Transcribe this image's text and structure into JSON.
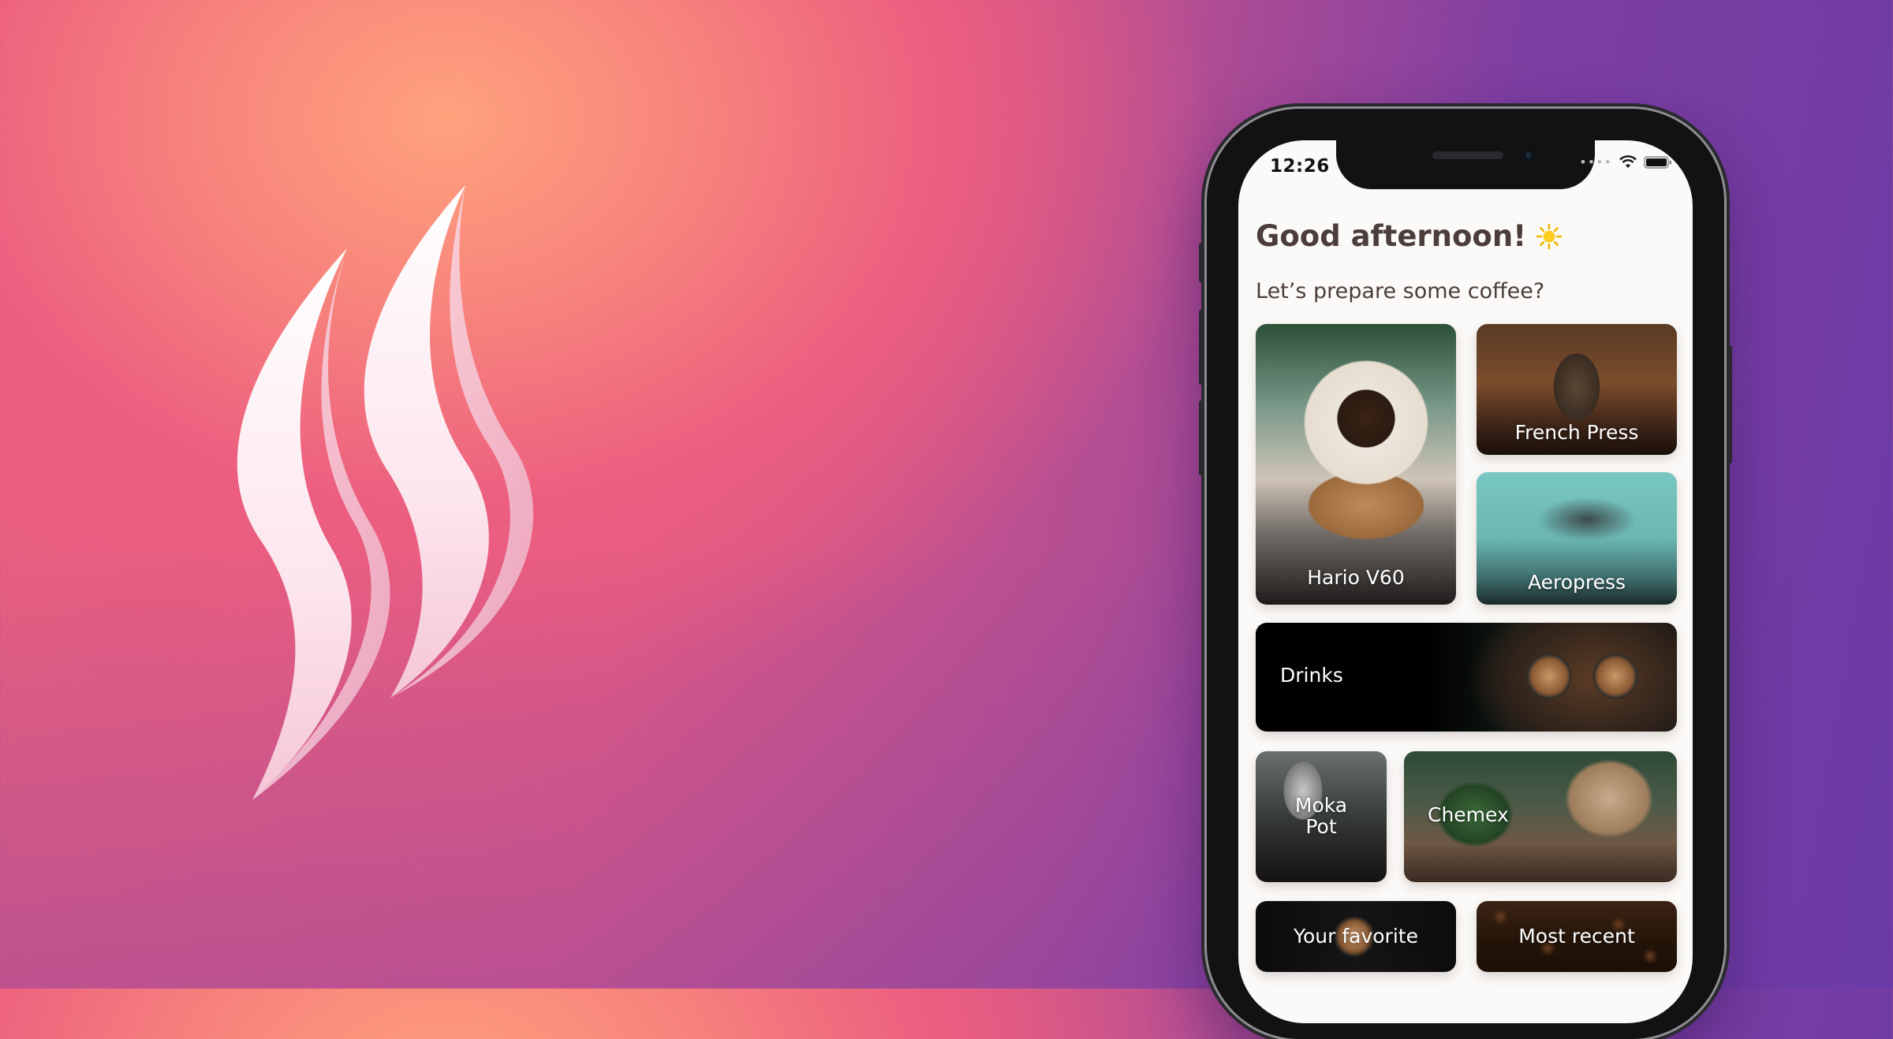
{
  "status_bar": {
    "time": "12:26",
    "icons": [
      "signal-dots-icon",
      "wifi-icon",
      "battery-icon"
    ]
  },
  "home": {
    "greeting": "Good afternoon!",
    "greeting_icon": "sun-icon",
    "subtitle": "Let’s prepare some coffee?"
  },
  "categories": [
    {
      "label": "Hario V60"
    },
    {
      "label": "French Press"
    },
    {
      "label": "Aeropress"
    },
    {
      "label": "Drinks"
    },
    {
      "label": "Moka\nPot"
    },
    {
      "label": "Chemex"
    },
    {
      "label": "Your favorite"
    },
    {
      "label": "Most recent"
    }
  ],
  "colors": {
    "background_start": "#ffa27d",
    "background_mid": "#ec5e80",
    "background_end": "#6b3aa5",
    "text_dark": "#4a3d3a",
    "screen_bg": "#fcfaf8"
  }
}
